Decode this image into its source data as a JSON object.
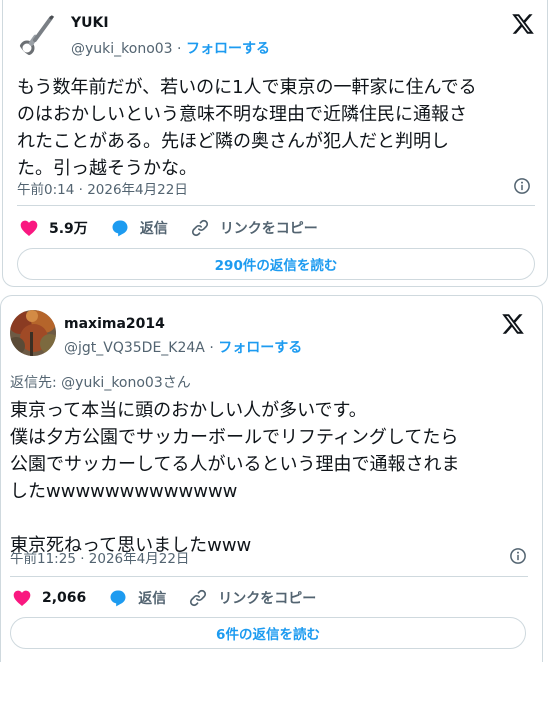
{
  "tweet1": {
    "name": "YUKI",
    "handle": "@yuki_kono03",
    "sep": " · ",
    "follow_label": "フォローする",
    "text": "もう数年前だが、若いのに1人で東京の一軒家に住んでる\nのはおかしいという意味不明な理由で近隣住民に通報さ\nれたことがある。先ほど隣の奥さんが犯人だと判明し\nた。引っ越そうかな。",
    "timestamp": "午前0:14 · 2026年4月22日",
    "likes": "5.9万",
    "reply_label": "返信",
    "copy_link_label": "リンクをコピー",
    "replies_button": "290件の返信を読む"
  },
  "tweet2": {
    "name": "maxima2014",
    "handle": "@jgt_VQ35DE_K24A",
    "sep": " · ",
    "follow_label": "フォローする",
    "reply_to": "返信先: @yuki_kono03さん",
    "text": "東京って本当に頭のおかしい人が多いです。\n僕は夕方公園でサッカーボールでリフティングしてたら\n公園でサッカーしてる人がいるという理由で通報されま\nしたwwwwwwwwwwwww\n\n東京死ねって思いましたwww",
    "timestamp": "午前11:25 · 2026年4月22日",
    "likes": "2,066",
    "reply_label": "返信",
    "copy_link_label": "リンクをコピー",
    "replies_button": "6件の返信を読む"
  },
  "colors": {
    "accent": "#1d9bf0",
    "like": "#f91880",
    "text": "#0f1419",
    "muted": "#536471",
    "border": "#cfd9de"
  },
  "icons": [
    "x-logo-icon",
    "info-icon",
    "heart-icon",
    "reply-bubble-icon",
    "link-icon"
  ]
}
